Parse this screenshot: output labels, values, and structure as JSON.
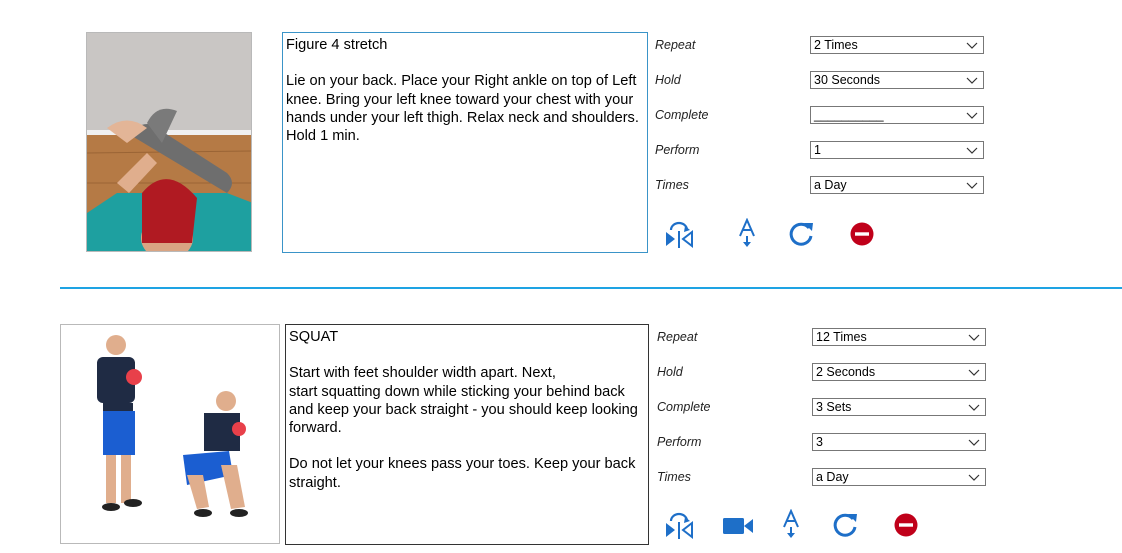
{
  "exercises": [
    {
      "title": "Figure 4 stretch",
      "description": "Lie on your back. Place your Right ankle on top of Left knee. Bring your left knee toward your chest with your hands under your left thigh. Relax neck and shoulders. Hold 1 min.",
      "options": [
        {
          "label": "Repeat",
          "value": "2 Times"
        },
        {
          "label": "Hold",
          "value": "30 Seconds"
        },
        {
          "label": "Complete",
          "value": "__________"
        },
        {
          "label": "Perform",
          "value": "1"
        },
        {
          "label": "Times",
          "value": "a Day"
        }
      ],
      "actions": [
        "mirror-icon",
        "text-size-icon",
        "refresh-icon",
        "remove-icon"
      ]
    },
    {
      "title": "SQUAT",
      "description": "Start with feet shoulder width apart. Next,\nstart squatting down while sticking your behind back and keep your back straight - you should keep looking forward.\n\nDo not let your knees pass your toes. Keep your back straight.",
      "options": [
        {
          "label": "Repeat",
          "value": "12 Times"
        },
        {
          "label": "Hold",
          "value": "2 Seconds"
        },
        {
          "label": "Complete",
          "value": "3 Sets"
        },
        {
          "label": "Perform",
          "value": "3"
        },
        {
          "label": "Times",
          "value": "a Day"
        }
      ],
      "actions": [
        "mirror-icon",
        "video-icon",
        "text-size-icon",
        "refresh-icon",
        "remove-icon"
      ]
    }
  ],
  "colors": {
    "accent": "#1e6fc8",
    "divider": "#1ea3e3",
    "remove": "#c0001a"
  }
}
